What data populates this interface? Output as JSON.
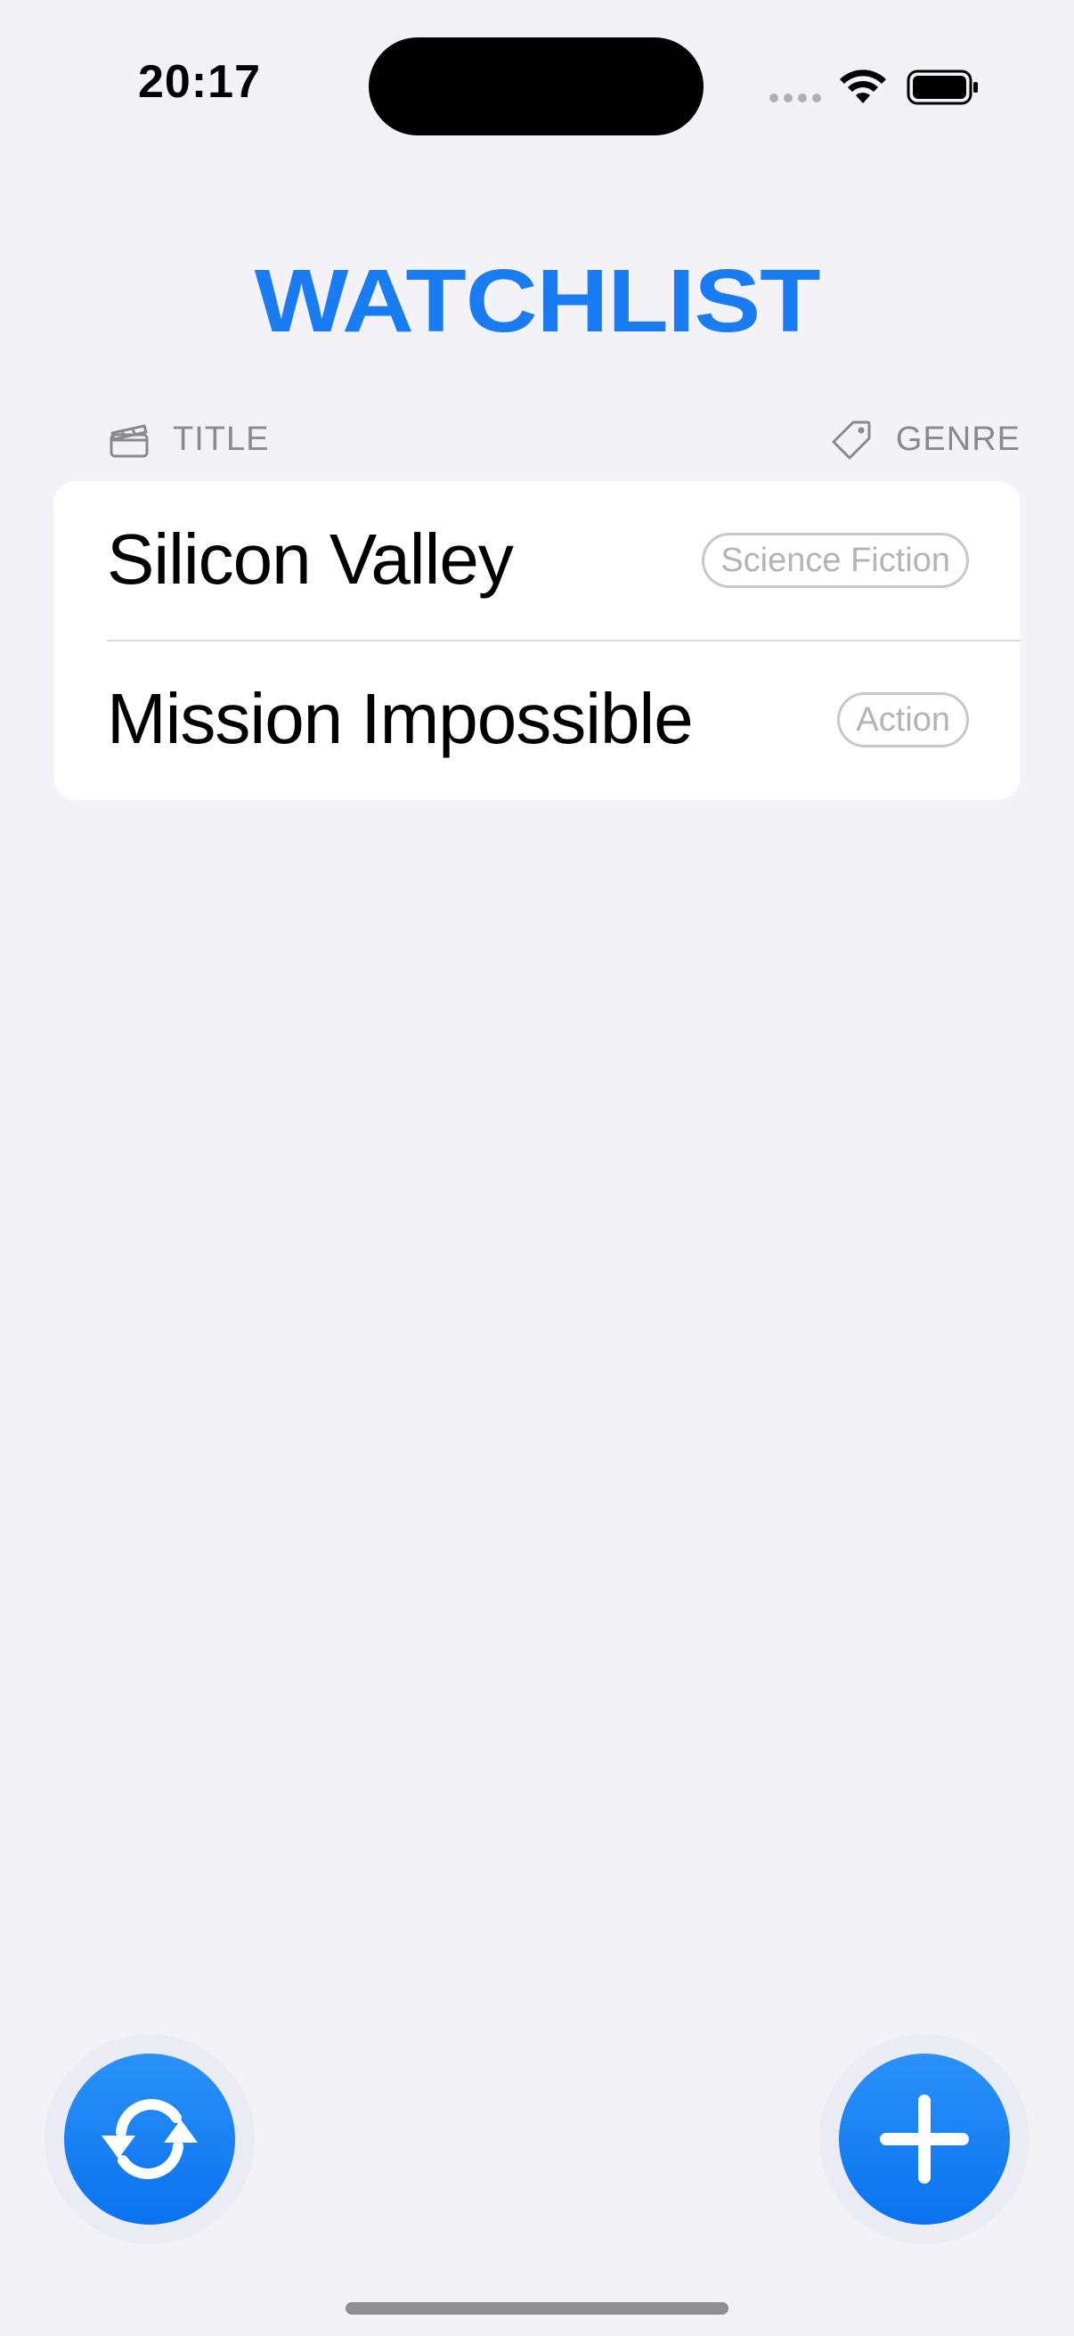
{
  "status_bar": {
    "time": "20:17",
    "icons": [
      "signal-dots-icon",
      "wifi-icon",
      "battery-icon"
    ]
  },
  "header": {
    "title": "WATCHLIST",
    "title_color": "#1a7cf3"
  },
  "columns": {
    "title_label": "TITLE",
    "title_icon": "clapperboard-icon",
    "genre_label": "GENRE",
    "genre_icon": "tag-icon"
  },
  "items": [
    {
      "title": "Silicon Valley",
      "genre": "Science Fiction"
    },
    {
      "title": "Mission Impossible",
      "genre": "Action"
    }
  ],
  "actions": {
    "refresh_icon": "refresh-icon",
    "add_icon": "plus-icon",
    "accent_color": "#0a7cf5"
  }
}
